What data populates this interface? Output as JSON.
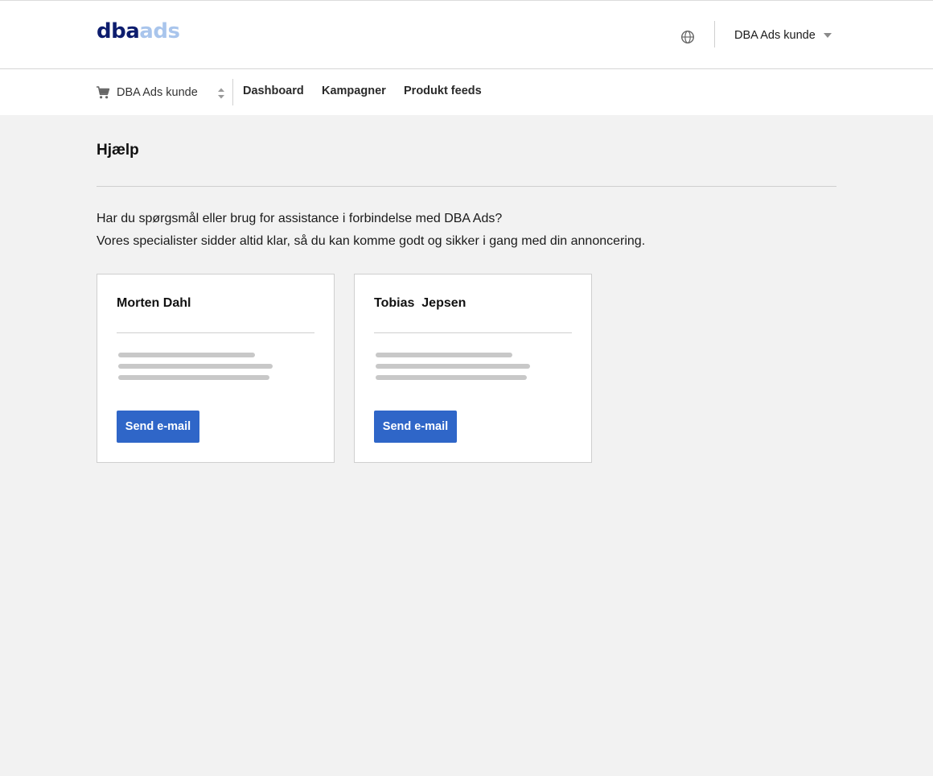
{
  "header": {
    "logo": {
      "part1": "dba",
      "part2": "ads",
      "color_dark": "#0d1d6e",
      "color_light": "#a9c5ec"
    },
    "language_icon": "globe-icon",
    "account_label": "DBA Ads kunde"
  },
  "subnav": {
    "cart_icon": "cart-icon",
    "customer_select_value": "DBA Ads kunde",
    "links": [
      "Dashboard",
      "Kampagner",
      "Produkt feeds"
    ]
  },
  "page": {
    "title": "Hjælp",
    "intro_line1": "Har du spørgsmål eller brug for assistance i forbindelse med DBA Ads?",
    "intro_line2": "Vores specialister sidder altid klar, så du kan komme godt og sikker i gang med din annoncering."
  },
  "contacts": [
    {
      "name": "Morten Dahl",
      "button_label": "Send e-mail"
    },
    {
      "name": "Tobias  Jepsen",
      "button_label": "Send e-mail"
    }
  ],
  "colors": {
    "accent": "#2f66c8",
    "background": "#f2f2f2"
  }
}
